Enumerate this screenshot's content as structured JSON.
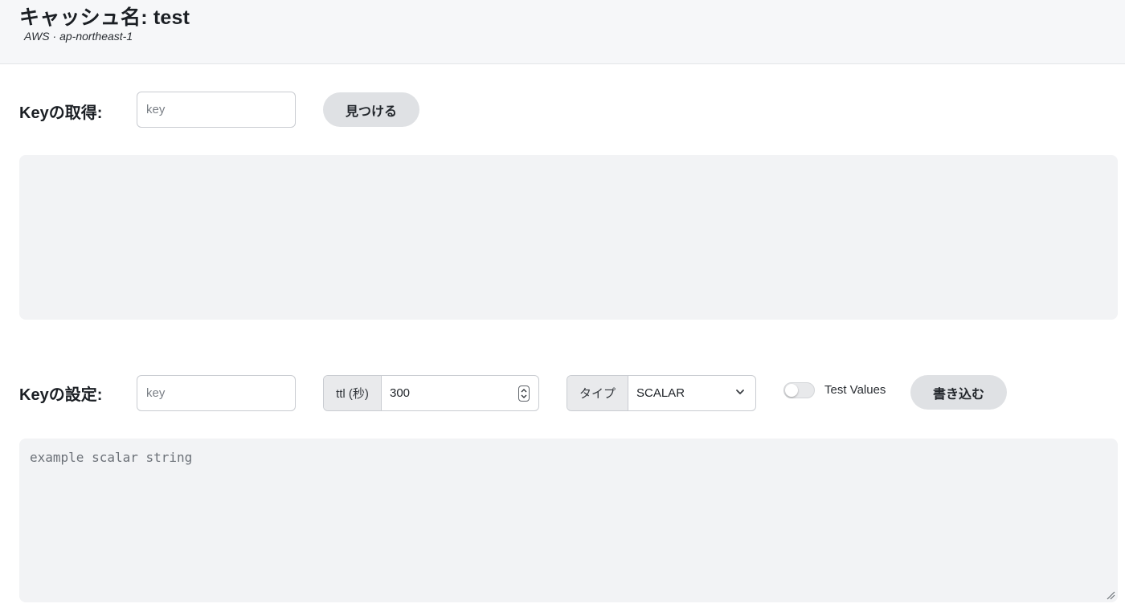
{
  "header": {
    "title": "キャッシュ名: test",
    "subtitle": "AWS · ap-northeast-1"
  },
  "get_key": {
    "label": "Keyの取得:",
    "input_placeholder": "key",
    "input_value": "",
    "find_button": "見つける"
  },
  "result": {
    "text": ""
  },
  "set_key": {
    "label": "Keyの設定:",
    "input_placeholder": "key",
    "input_value": "",
    "ttl_label": "ttl (秒)",
    "ttl_value": "300",
    "type_label": "タイプ",
    "type_value": "SCALAR",
    "test_values_label": "Test Values",
    "test_values_enabled": false,
    "write_button": "書き込む",
    "value_placeholder": "example scalar string",
    "value_text": ""
  },
  "colors": {
    "header_bg": "#f6f7f9",
    "button_bg": "#dfe1e4",
    "panel_bg": "#f2f3f5",
    "addon_bg": "#e9eaec"
  },
  "icons": {
    "ttl_spinner": "up-down-stepper-icon",
    "type_dropdown": "chevron-down-icon",
    "textarea_resize": "resize-grip-icon"
  }
}
